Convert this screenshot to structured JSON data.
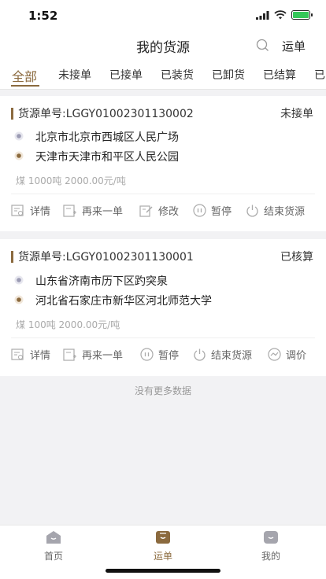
{
  "status": {
    "time": "1:52"
  },
  "nav": {
    "title": "我的货源",
    "right_label": "运单"
  },
  "tabs": [
    "全部",
    "未接单",
    "已接单",
    "已装货",
    "已卸货",
    "已结算",
    "已"
  ],
  "cards": [
    {
      "number": "货源单号:LGGY01002301130002",
      "status": "未接单",
      "from": "北京市北京市西城区人民广场",
      "to": "天津市天津市和平区人民公园",
      "cargo": "煤 1000吨 2000.00元/吨",
      "actions": [
        "详情",
        "再来一单",
        "修改",
        "暂停",
        "结束货源"
      ]
    },
    {
      "number": "货源单号:LGGY01002301130001",
      "status": "已核算",
      "from": "山东省济南市历下区趵突泉",
      "to": "河北省石家庄市新华区河北师范大学",
      "cargo": "煤 100吨 2000.00元/吨",
      "actions": [
        "详情",
        "再来一单",
        "暂停",
        "结束货源",
        "调价"
      ]
    }
  ],
  "footer_note": "没有更多数据",
  "tabbar": [
    "首页",
    "运单",
    "我的"
  ],
  "colors": {
    "accent": "#8b6a3e",
    "battery": "#34c759"
  }
}
